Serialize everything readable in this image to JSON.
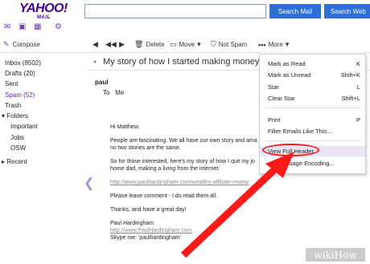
{
  "header": {
    "logo": "YAHOO!",
    "logo_sub": "MAIL",
    "search_mail_label": "Search Mail",
    "search_web_label": "Search Web"
  },
  "toolbar": {
    "compose": "Compose",
    "delete": "Delete",
    "move": "Move",
    "not_spam": "Not Spam",
    "more": "More"
  },
  "sidebar": {
    "inbox": "Inbox (8502)",
    "drafts": "Drafts (20)",
    "sent": "Sent",
    "spam": "Spam (52)",
    "trash": "Trash",
    "folders": "Folders",
    "important": "Important",
    "jobs": "Jobs",
    "osw": "OSW",
    "recent": "Recent"
  },
  "message": {
    "subject": "My story of how I started making money o",
    "sender": "paul",
    "to_label": "To",
    "to_value": "Me",
    "greeting": "Hi Matthew,",
    "p1": "People are fascinating. We all have our own story and ama",
    "p1b": "no two stories are the same.",
    "p2": "So for those interested, here's my story of how I quit my jo",
    "p2b": "home dad, making a living from the internet:",
    "link1": "http://www.paulhardingham.com/wealthy-affiliate-review",
    "p3": "Please leave comment - I do read them all.",
    "p4": "Thanks, and have a great day!",
    "sig_name": "Paul Hardingham",
    "sig_link": "http://www.PaulHardingham.com",
    "skype": "Skype me: 'paulhardingham'"
  },
  "menu": {
    "items": [
      {
        "label": "Mark as Read",
        "key": "K"
      },
      {
        "label": "Mark as Unread",
        "key": "Shift+K"
      },
      {
        "label": "Star",
        "key": "L"
      },
      {
        "label": "Clear Star",
        "key": "Shift+L"
      },
      {
        "label": "Print",
        "key": "P"
      },
      {
        "label": "Filter Emails Like This...",
        "key": ""
      },
      {
        "label": "View Full Header",
        "key": ""
      },
      {
        "label": "nguage Encoding...",
        "key": ""
      }
    ]
  },
  "watermark": "wikiHow",
  "colors": {
    "brand": "#400090",
    "search_button": "#2d6fd6",
    "highlight_red": "#ff1a1a"
  }
}
